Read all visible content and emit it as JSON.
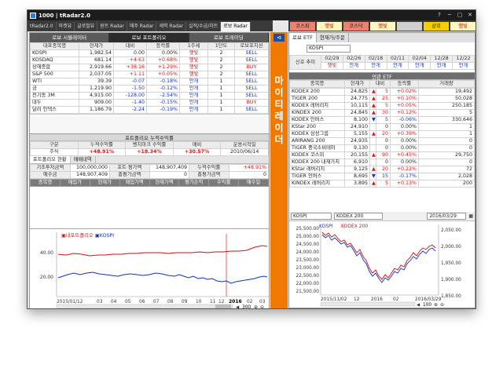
{
  "window": {
    "title": "1000 | tRadar2.0",
    "controls": [
      "?",
      "─",
      "▢",
      "✕"
    ]
  },
  "menu_tabs": [
    "tRadar2.0",
    "마켓뷰",
    "글로벌뷰",
    "원트 Radar",
    "매주 Radar",
    "세력 Radar",
    "실적/수급/차트",
    "로보 Radar"
  ],
  "market_buttons": [
    {
      "label": "코스피",
      "bg": "#f08070"
    },
    {
      "label": "햇빛",
      "bg": "#fff6c0"
    },
    {
      "label": "코스닥",
      "bg": "#f08070"
    },
    {
      "label": "햇빛",
      "bg": "#fff6c0"
    },
    {
      "label": "",
      "bg": "#d0d0d0"
    },
    {
      "label": "상위",
      "bg": "#f5d000"
    },
    {
      "label": "햇빛",
      "bg": "#fff6c0"
    }
  ],
  "left_subtabs": [
    "로보 시뮬레이터",
    "로보 포트폴리오",
    "로보 트레이딩"
  ],
  "stock_table": {
    "headers": [
      "대표종목명",
      "현재가",
      "대비",
      "등락률",
      "1주세",
      "1단도",
      "로보포지션"
    ],
    "rows": [
      [
        "KOSPI",
        "1,982.54",
        "0.00",
        "0.00%",
        "햇빛",
        "2",
        "SELL"
      ],
      [
        "KOSDAQ",
        "681.14",
        "+4.63",
        "+0.68%",
        "햇빛",
        "2",
        "SELL"
      ],
      [
        "상해종합",
        "2,919.66",
        "+38.16",
        "+1.29%",
        "햇빛",
        "2",
        "BUY"
      ],
      [
        "S&P 500",
        "2,037.05",
        "+1.11",
        "+0.05%",
        "햇빛",
        "2",
        "SELL"
      ],
      [
        "WTI",
        "39.39",
        "-0.07",
        "-0.18%",
        "안개",
        "1",
        "SELL"
      ],
      [
        "금",
        "1,219.90",
        "-1.50",
        "-0.12%",
        "안개",
        "1",
        "SELL"
      ],
      [
        "전기동 3M",
        "4,915.00",
        "-128.00",
        "-2.54%",
        "안개",
        "1",
        "SELL"
      ],
      [
        "대두",
        "909.00",
        "-1.40",
        "-0.15%",
        "안개",
        "1",
        "BUY"
      ],
      [
        "달러 인덱스",
        "1,186.79",
        "-2.24",
        "-0.19%",
        "안개",
        "1",
        "SELL"
      ]
    ]
  },
  "portfolio_return": {
    "section_title": "포트폴리오 누적수익률",
    "headers": [
      "구분",
      "누적수익률",
      "벤치마크 수익률",
      "매비",
      "운용시작일"
    ],
    "row": [
      "주식",
      "+48.91%",
      "+18.34%",
      "+30.57%",
      "2010/06/14"
    ]
  },
  "portfolio_tabs": [
    "포트폴리오 현황",
    "매매내역"
  ],
  "holdings_summary": [
    [
      "기초투자금액",
      "100,000,000",
      "포트 평가액",
      "148,907,409",
      "누적수익률",
      "+48.91%"
    ],
    [
      "예수금",
      "148,907,409",
      "총평가금액",
      "0",
      "총평가금액",
      "0"
    ]
  ],
  "holdings_headers": [
    "종목명",
    "매입가",
    "현재가",
    "매입가액",
    "현재가액",
    "평가손익",
    "수익률",
    "매수일"
  ],
  "left_chart": {
    "legend_portfolio": "내포트폴리오",
    "legend_kospi": "KOSPI",
    "y_ticks": [
      "40.00",
      "20.00"
    ],
    "x_ticks": [
      "2015/01/12",
      "03",
      "04",
      "05",
      "06",
      "07",
      "08",
      "09",
      "10",
      "11",
      "12",
      "2016",
      "02",
      "03"
    ],
    "zoom_value": "300"
  },
  "right_tabs": [
    "로보 ETF",
    "현재가/주문"
  ],
  "kospi_select": "KOSPI",
  "signal_table": {
    "label": "신호 추이",
    "dates": [
      "02/29",
      "02/26",
      "02/18",
      "02/11",
      "02/04",
      "12/28",
      "12/22"
    ],
    "signals": [
      "햇빛",
      "안개",
      "안개",
      "안개",
      "안개",
      "안개",
      "안개"
    ]
  },
  "etf_section_title": "연관 ETF",
  "etf_table": {
    "headers": [
      "종목명",
      "현재가",
      "대비",
      "등락률",
      "거래량"
    ],
    "rows": [
      [
        "KODEX 200",
        "24,825",
        "▲",
        "5",
        "+0.02%",
        "19,492"
      ],
      [
        "TIGER 200",
        "24,775",
        "▲",
        "25",
        "+0.10%",
        "50,028"
      ],
      [
        "KODEX 레버리지",
        "10,115",
        "▲",
        "5",
        "+0.05%",
        "250,185"
      ],
      [
        "KINDEX 200",
        "24,845",
        "▲",
        "30",
        "+0.12%",
        "5"
      ],
      [
        "KODEX 인버스",
        "8,100",
        "▼",
        "5",
        "-0.06%",
        "330,646"
      ],
      [
        "KStar 200",
        "24,910",
        "",
        "0",
        "0.00%",
        "1"
      ],
      [
        "KODEX 삼성그룹",
        "5,155",
        "▲",
        "20",
        "+0.39%",
        "1"
      ],
      [
        "ARIRANG 200",
        "24,935",
        "",
        "0",
        "0.00%",
        "0"
      ],
      [
        "TIGER 중국소비테마",
        "9,130",
        "",
        "0",
        "0.00%",
        "0"
      ],
      [
        "KODEX 코스피",
        "20,155",
        "▲",
        "90",
        "+0.45%",
        "29,750"
      ],
      [
        "KODEX 200 내재가치",
        "6,910",
        "",
        "0",
        "0.00%",
        "0"
      ],
      [
        "KStar 레버리지",
        "9,125",
        "▲",
        "20",
        "+0.22%",
        "72"
      ],
      [
        "TIGER 인버스",
        "8,695",
        "▼",
        "15",
        "-0.17%",
        "2,028"
      ],
      [
        "KINDEX 레버리지",
        "3,895",
        "▲",
        "5",
        "+0.13%",
        "200"
      ]
    ]
  },
  "right_chart": {
    "symbol": "KOSPI",
    "etf": "KODEX 200",
    "date": "2016/03/29",
    "legend_kospi": "KOSPI",
    "legend_kodex": "KODEX 200",
    "y_left": [
      "25,500.00",
      "25,000.00",
      "24,500.00",
      "24,000.00",
      "23,500.00",
      "23,000.00",
      "22,500.00",
      "22,000.00",
      "21,500.00"
    ],
    "y_right": [
      "2,050.00",
      "2,000.00",
      "1,950.00",
      "1,900.00",
      "1,850.00"
    ],
    "x_ticks": [
      "2015/11/02",
      "12",
      "2016",
      "02",
      "2016/03/29"
    ],
    "zoom_value": "100"
  },
  "side_strip_text": "마이티레이더"
}
